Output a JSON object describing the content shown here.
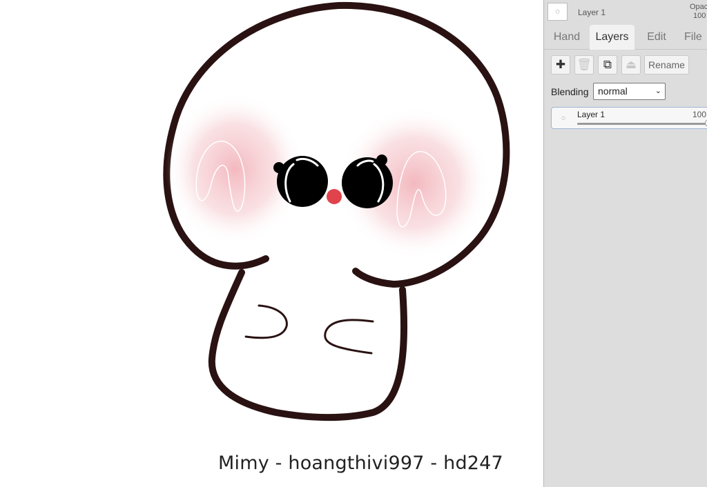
{
  "canvas": {
    "caption": "Mimy - hoangthivi997 - hd247"
  },
  "sidebar": {
    "current_layer": {
      "name": "Layer 1",
      "opacity_label": "Opac",
      "opacity_value": "100"
    },
    "tabs": [
      {
        "label": "Hand",
        "active": false
      },
      {
        "label": "Layers",
        "active": true
      },
      {
        "label": "Edit",
        "active": false
      },
      {
        "label": "File",
        "active": false
      }
    ],
    "toolbar": {
      "add_icon": "plus-icon",
      "delete_icon": "trash-icon",
      "duplicate_icon": "duplicate-icon",
      "merge_icon": "merge-down-icon",
      "rename_label": "Rename"
    },
    "blending": {
      "label": "Blending",
      "value": "normal"
    },
    "layers": [
      {
        "name": "Layer 1",
        "opacity": "100",
        "opacity_fraction": 1.0
      }
    ]
  },
  "colors": {
    "outline": "#2a1212",
    "blush": "#f2b5bc",
    "nose": "#e0434b",
    "panel_bg": "#dddddd",
    "active_tab": "#f2f2f2",
    "selected_border": "#9fb4d8"
  }
}
